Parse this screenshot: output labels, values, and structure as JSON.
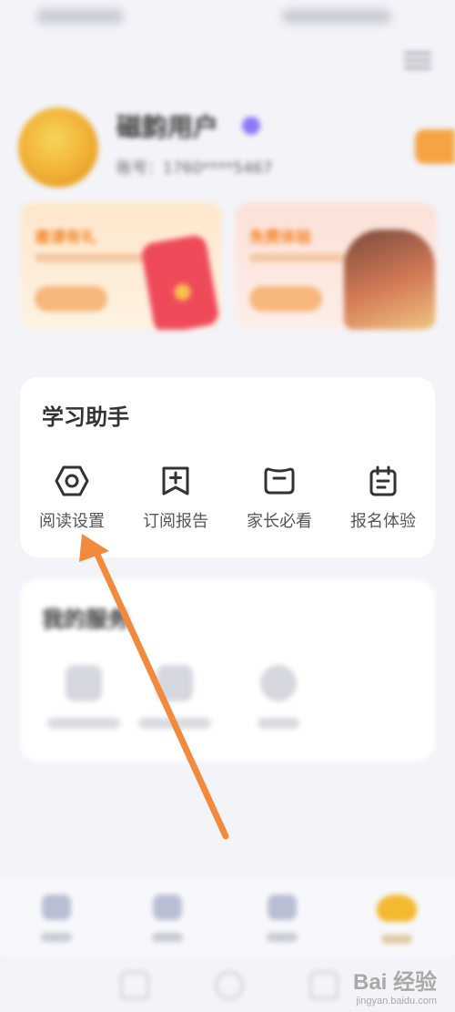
{
  "profile": {
    "name": "磁韵用户",
    "account": "账号：1760****5467",
    "vip_color": "#8b79f5"
  },
  "banners": [
    {
      "title": "邀请有礼"
    },
    {
      "title": "免费体验"
    }
  ],
  "study_assistant": {
    "title": "学习助手",
    "items": [
      {
        "label": "阅读设置",
        "icon": "hexagon-settings-icon"
      },
      {
        "label": "订阅报告",
        "icon": "bookmark-plus-icon"
      },
      {
        "label": "家长必看",
        "icon": "message-box-icon"
      },
      {
        "label": "报名体验",
        "icon": "calendar-icon"
      }
    ]
  },
  "my_services": {
    "title": "我的服务",
    "items": [
      {
        "icon": "folder-icon"
      },
      {
        "icon": "briefcase-icon"
      },
      {
        "icon": "support-icon"
      }
    ]
  },
  "bottom_nav": {
    "items": [
      {
        "icon": "home-icon"
      },
      {
        "icon": "course-icon"
      },
      {
        "icon": "message-icon"
      },
      {
        "icon": "mine-icon",
        "active": true
      }
    ]
  },
  "watermark": {
    "brand": "Bai 经验",
    "site": "jingyan.baidu.com"
  },
  "colors": {
    "accent": "#f4a445",
    "annotation_arrow": "#f28a3d"
  }
}
